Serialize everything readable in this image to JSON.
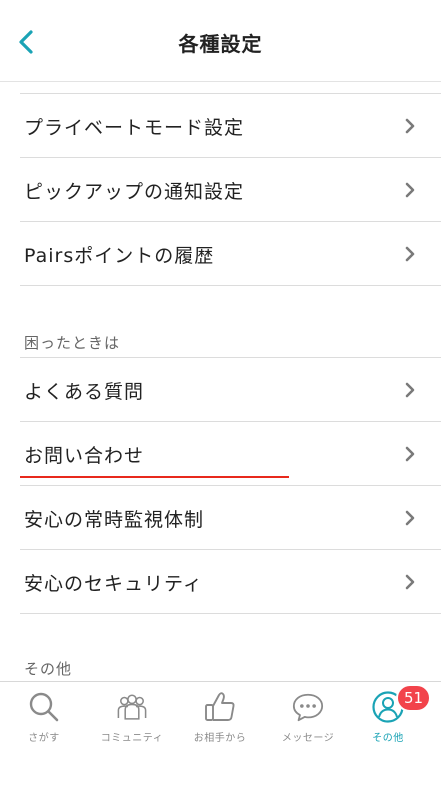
{
  "header": {
    "title": "各種設定",
    "back_icon": "chevron-left-icon",
    "accent": "#1aa3b5"
  },
  "list_items": [
    {
      "label": "プライベートモード設定"
    },
    {
      "label": "ピックアップの通知設定"
    },
    {
      "label": "Pairsポイントの履歴"
    }
  ],
  "sections": {
    "trouble": {
      "title": "困ったときは",
      "items": [
        {
          "label": "よくある質問"
        },
        {
          "label": "お問い合わせ"
        },
        {
          "label": "安心の常時監視体制"
        },
        {
          "label": "安心のセキュリティ"
        }
      ]
    },
    "other": {
      "title": "その他"
    }
  },
  "highlight_color": "#e8291c",
  "tabbar": {
    "tabs": [
      {
        "label": "さがす",
        "icon": "search-icon"
      },
      {
        "label": "コミュニティ",
        "icon": "community-icon"
      },
      {
        "label": "お相手から",
        "icon": "thumbs-up-icon"
      },
      {
        "label": "メッセージ",
        "icon": "speech-bubble-icon"
      },
      {
        "label": "その他",
        "icon": "profile-icon",
        "active": true
      }
    ],
    "badge": "51",
    "badge_color": "#f2434b"
  }
}
